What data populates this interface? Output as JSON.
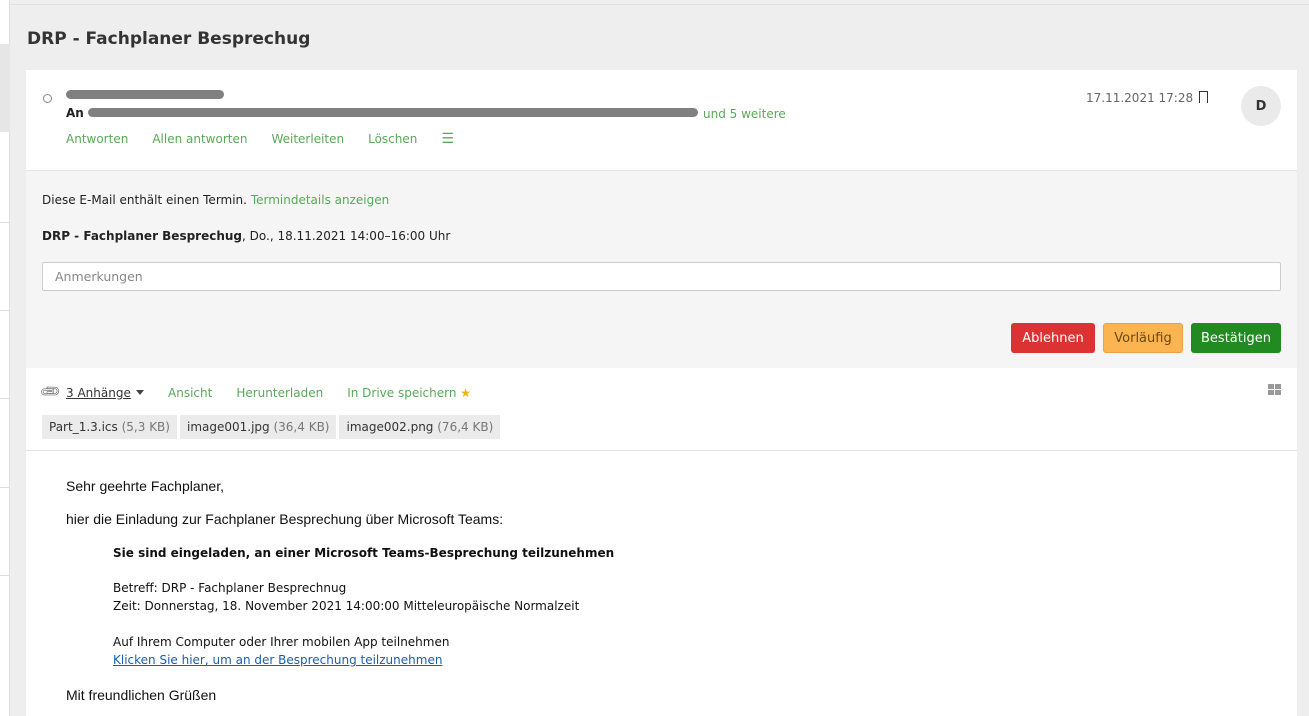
{
  "title": "DRP - Fachplaner Besprechug",
  "header": {
    "to_label": "An",
    "more_recipients": "und 5 weitere",
    "date": "17.11.2021 17:28",
    "avatar": "D",
    "actions": [
      "Antworten",
      "Allen antworten",
      "Weiterleiten",
      "Löschen"
    ]
  },
  "appointment": {
    "info": "Diese E-Mail enthält einen Termin.",
    "details_link": "Termindetails anzeigen",
    "event_title": "DRP - Fachplaner Besprechug",
    "event_time": ", Do., 18.11.2021 14:00–16:00 Uhr",
    "notes_placeholder": "Anmerkungen",
    "decline": "Ablehnen",
    "tentative": "Vorläufig",
    "accept": "Bestätigen"
  },
  "attachments": {
    "count_label": "3 Anhänge",
    "view": "Ansicht",
    "download": "Herunterladen",
    "save_drive": "In Drive speichern",
    "files": [
      {
        "name": "Part_1.3.ics",
        "size": "(5,3 KB)"
      },
      {
        "name": "image001.jpg",
        "size": "(36,4 KB)"
      },
      {
        "name": "image002.png",
        "size": "(76,4 KB)"
      }
    ]
  },
  "body": {
    "greeting": "Sehr geehrte Fachplaner,",
    "intro": "hier die Einladung zur Fachplaner Besprechung über Microsoft Teams:",
    "invite_heading": "Sie sind eingeladen, an einer Microsoft Teams-Besprechung teilzunehmen",
    "subject": "Betreff: DRP - Fachplaner Besprechnug",
    "time": "Zeit: Donnerstag, 18. November 2021 14:00:00 Mitteleuropäische Normalzeit",
    "join_text": "Auf Ihrem Computer oder Ihrer mobilen App teilnehmen",
    "join_link": "Klicken Sie hier, um an der Besprechung teilzunehmen",
    "closing": "Mit freundlichen Grüßen"
  },
  "colors": {
    "accent": "#5aa85a",
    "decline": "#dc3232",
    "tentative": "#fbb450",
    "accept": "#218a21"
  }
}
